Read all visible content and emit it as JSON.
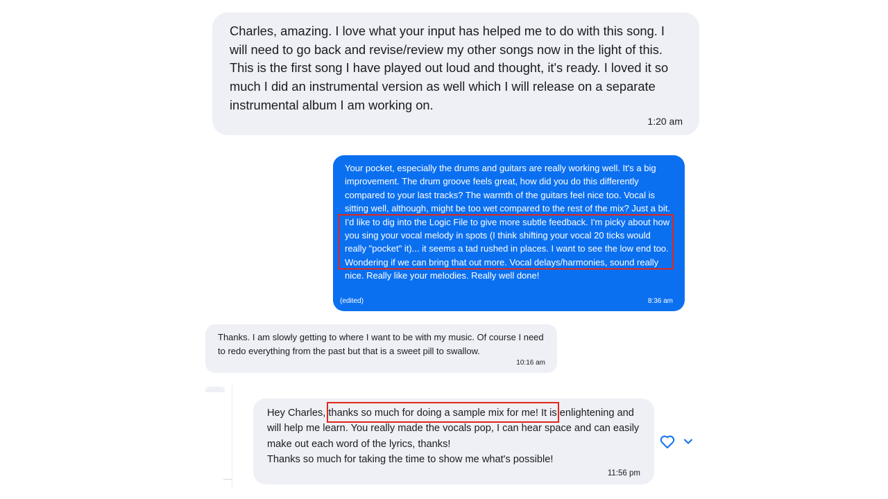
{
  "conversation": {
    "messages": [
      {
        "direction": "incoming",
        "text": "Charles, amazing.  I love what your input has helped me to do with this song.  I will need to go back and revise/review my other songs now in the light of this. This is the first song I have played out loud and thought, it's ready.  I loved it so much I did an instrumental version as well which I will release on a separate instrumental album I am working on.",
        "time": "1:20 am"
      },
      {
        "direction": "outgoing",
        "text": "Your pocket, especially the drums and guitars are really working well. It's a big improvement. The drum groove feels great, how did you do this differently compared to your last tracks? The warmth of the guitars feel nice too. Vocal is sitting well, although, might be too wet compared to the rest of the mix? Just a bit. I'd like to dig into the Logic File to give more subtle feedback. I'm picky about how you sing your vocal melody in spots (I think shifting your vocal 20 ticks would really \"pocket\" it)... it seems a tad rushed in places. I want to see the low end too. Wondering if we can bring that out more. Vocal delays/harmonies, sound really nice. Really like your melodies. Really well done!",
        "edited_label": "(edited)",
        "time": "8:36 am"
      },
      {
        "direction": "incoming",
        "text": "Thanks. I am slowly getting to where I want to be with my music. Of course I need to redo everything from the past but that is a sweet pill to swallow.",
        "time": "10:16 am"
      },
      {
        "direction": "incoming",
        "text": "Hey Charles, thanks so much for doing a sample mix for me! It is enlightening and will help me learn. You really made the vocals pop, I can hear space and can easily make out each word of the lyrics, thanks!\nThanks so much for taking the time to show me what's possible!",
        "time": "11:56 pm",
        "actions": [
          "heart-icon",
          "chevron-down-icon"
        ]
      }
    ]
  },
  "colors": {
    "incoming_bubble": "#eef0f5",
    "outgoing_bubble": "#0b70f0",
    "highlight": "#e0271c",
    "action_icon": "#0b70f0"
  }
}
